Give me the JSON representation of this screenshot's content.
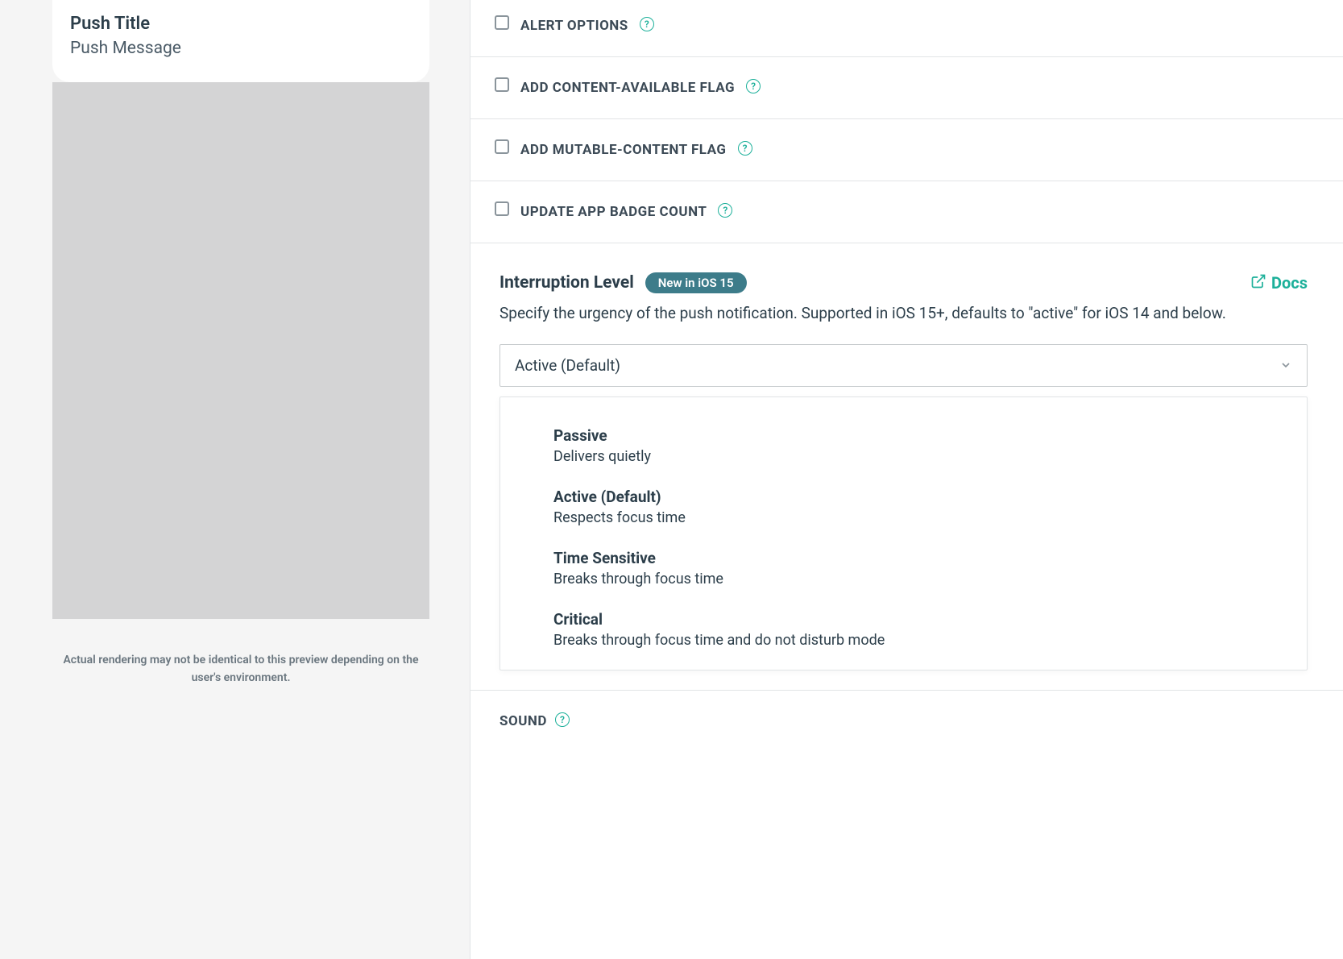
{
  "preview": {
    "title": "Push Title",
    "message": "Push Message"
  },
  "disclaimer": "Actual rendering may not be identical to this preview depending on the user's environment.",
  "options": [
    {
      "label": "ALERT OPTIONS"
    },
    {
      "label": "ADD CONTENT-AVAILABLE FLAG"
    },
    {
      "label": "ADD MUTABLE-CONTENT FLAG"
    },
    {
      "label": "UPDATE APP BADGE COUNT"
    }
  ],
  "interruption": {
    "title": "Interruption Level",
    "badge": "New in iOS 15",
    "docs_label": "Docs",
    "description": "Specify the urgency of the push notification. Supported in iOS 15+, defaults to \"active\" for iOS 14 and below.",
    "selected": "Active (Default)",
    "choices": [
      {
        "title": "Passive",
        "desc": "Delivers quietly"
      },
      {
        "title": "Active (Default)",
        "desc": "Respects focus time"
      },
      {
        "title": "Time Sensitive",
        "desc": "Breaks through focus time"
      },
      {
        "title": "Critical",
        "desc": "Breaks through focus time and do not disturb mode"
      }
    ]
  },
  "sound_label": "SOUND"
}
